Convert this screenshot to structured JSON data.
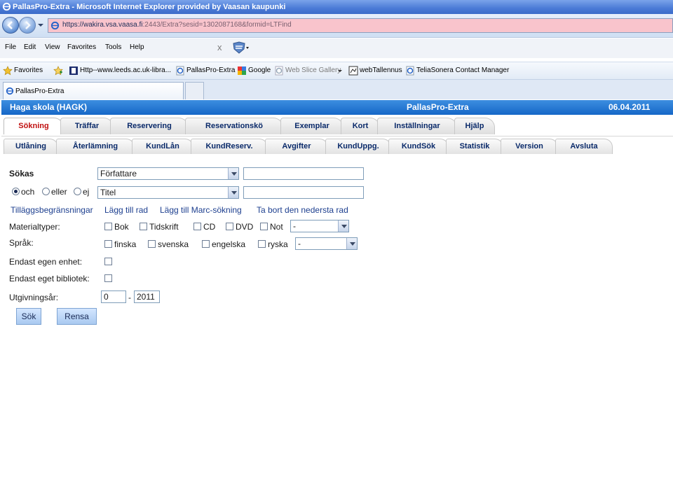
{
  "window": {
    "title": "PallasPro-Extra - Microsoft Internet Explorer provided by Vaasan kaupunki",
    "url_host": "https://wakira.vsa.vaasa.fi",
    "url_rest": ":2443/Extra?sesid=1302087168&formid=LTFind"
  },
  "menu": {
    "items": [
      "File",
      "Edit",
      "View",
      "Favorites",
      "Tools",
      "Help"
    ],
    "close_glyph": "x"
  },
  "favorites_bar": {
    "label": "Favorites",
    "items": [
      "Http--www.leeds.ac.uk-libra...",
      "PallasPro-Extra",
      "Google",
      "Web Slice Gallery",
      "webTallennus",
      "TeliaSonera Contact Manager"
    ]
  },
  "browser_tab": {
    "label": "PallasPro-Extra"
  },
  "app_header": {
    "library": "Haga skola (HAGK)",
    "app": "PallasPro-Extra",
    "date": "06.04.2011"
  },
  "main_tabs": [
    "Sökning",
    "Träffar",
    "Reservering",
    "Reservationskö",
    "Exemplar",
    "Kort",
    "Inställningar",
    "Hjälp"
  ],
  "sub_tabs": [
    "Utlåning",
    "Återlämning",
    "KundLån",
    "KundReserv.",
    "Avgifter",
    "KundUppg.",
    "KundSök",
    "Statistik",
    "Version",
    "Avsluta"
  ],
  "form": {
    "search_label": "Sökas",
    "field1_select": "Författare",
    "field1_value": "",
    "operators": [
      "och",
      "eller",
      "ej"
    ],
    "selected_operator": "och",
    "field2_select": "Titel",
    "field2_value": "",
    "links": [
      "Tilläggsbegränsningar",
      "Lägg till rad",
      "Lägg till Marc-sökning",
      "Ta bort den nedersta rad"
    ],
    "material_label": "Materialtyper:",
    "material_types": [
      "Bok",
      "Tidskrift",
      "CD",
      "DVD",
      "Not"
    ],
    "material_select": "-",
    "language_label": "Språk:",
    "languages": [
      "finska",
      "svenska",
      "engelska",
      "ryska"
    ],
    "language_select": "-",
    "own_unit_label": "Endast egen enhet:",
    "own_library_label": "Endast eget bibliotek:",
    "year_label": "Utgivningsår:",
    "year_from": "0",
    "year_separator": "-",
    "year_to": "2011",
    "search_button": "Sök",
    "clear_button": "Rensa"
  }
}
